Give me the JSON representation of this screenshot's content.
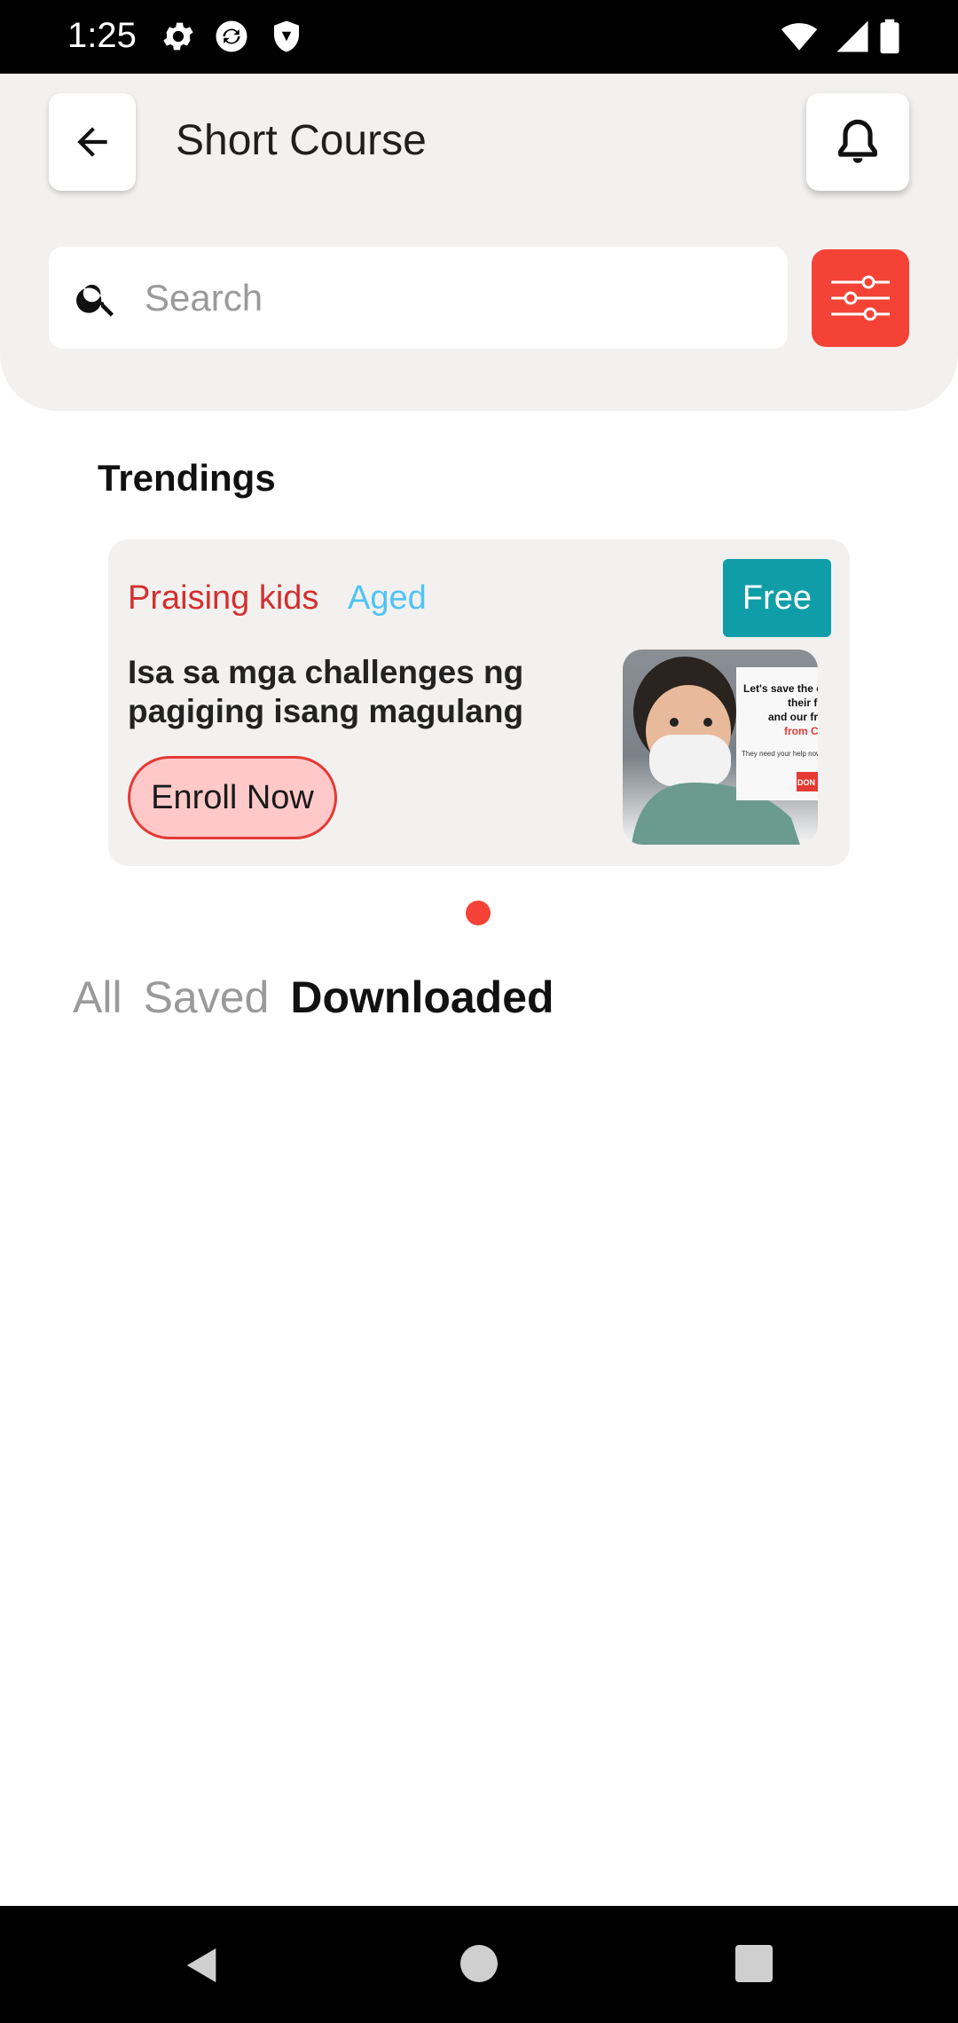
{
  "status_bar": {
    "time": "1:25",
    "icons": [
      "gear-icon",
      "sync-icon",
      "shield-icon",
      "wifi-icon",
      "signal-icon",
      "battery-icon"
    ]
  },
  "header": {
    "title": "Short Course",
    "back_icon": "arrow-left-icon",
    "bell_icon": "bell-icon"
  },
  "search": {
    "placeholder": "Search",
    "value": "",
    "filter_icon": "sliders-icon"
  },
  "trendings": {
    "title": "Trendings",
    "cards": [
      {
        "category": "Praising kids",
        "audience": "Aged",
        "badge": "Free",
        "description": "Isa sa mga challenges ng pagiging isang magulang",
        "button": "Enroll Now",
        "thumbnail_text": {
          "line1": "Let's save the c",
          "line2": "their f",
          "line3": "and our fr",
          "line4": "from C",
          "small": "They need your help now m",
          "tag": "DON"
        }
      }
    ]
  },
  "tabs": [
    {
      "label": "All",
      "active": false
    },
    {
      "label": "Saved",
      "active": false
    },
    {
      "label": "Downloaded",
      "active": true
    }
  ],
  "colors": {
    "accent": "#f44336",
    "badge": "#0f9ea8",
    "category": "#d32f2f",
    "audience": "#4fc3f7",
    "panel": "#f2f1ef"
  }
}
